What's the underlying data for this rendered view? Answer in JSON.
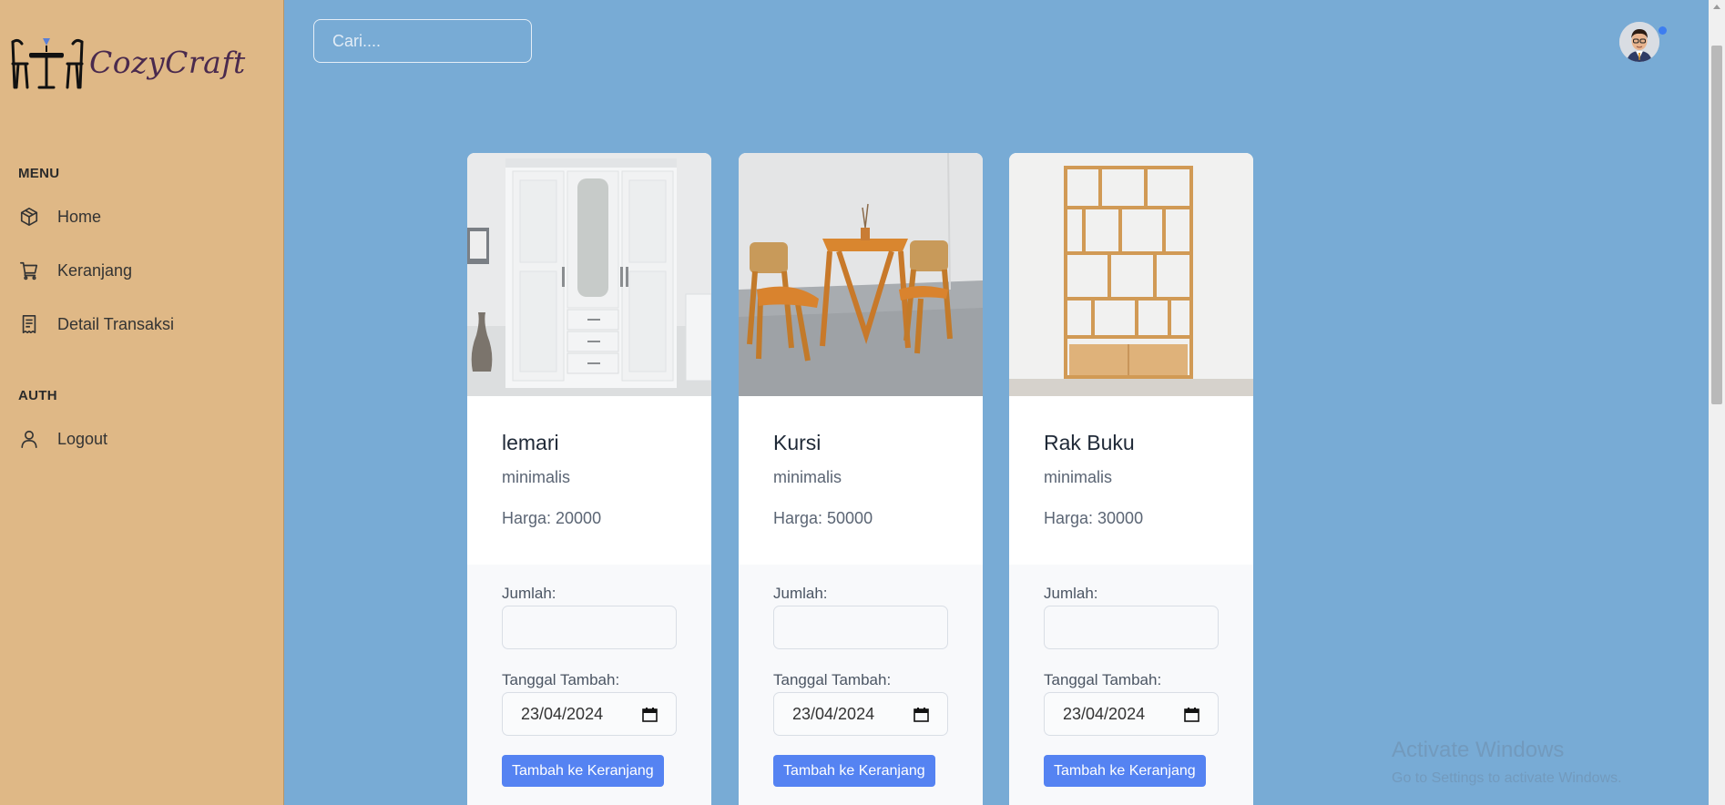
{
  "brand": {
    "name": "CozyCraft"
  },
  "sidebar": {
    "menu_title": "MENU",
    "items": [
      {
        "label": "Home",
        "icon": "box-icon"
      },
      {
        "label": "Keranjang",
        "icon": "cart-icon"
      },
      {
        "label": "Detail Transaksi",
        "icon": "receipt-icon"
      }
    ],
    "auth_title": "AUTH",
    "auth_items": [
      {
        "label": "Logout",
        "icon": "user-icon"
      }
    ]
  },
  "header": {
    "search_placeholder": "Cari....",
    "search_value": "",
    "avatar_icon": "avatar-icon",
    "status_color": "#3d7df0"
  },
  "products": [
    {
      "name": "lemari",
      "description": "minimalis",
      "price_text": "Harga: 20000",
      "image_icon": "wardrobe-image",
      "qty_label": "Jumlah:",
      "qty_value": "",
      "date_label": "Tanggal Tambah:",
      "date_value": "23/04/2024",
      "button_label": "Tambah ke Keranjang"
    },
    {
      "name": "Kursi",
      "description": "minimalis",
      "price_text": "Harga: 50000",
      "image_icon": "chairs-table-image",
      "qty_label": "Jumlah:",
      "qty_value": "",
      "date_label": "Tanggal Tambah:",
      "date_value": "23/04/2024",
      "button_label": "Tambah ke Keranjang"
    },
    {
      "name": "Rak Buku",
      "description": "minimalis",
      "price_text": "Harga: 30000",
      "image_icon": "bookshelf-image",
      "qty_label": "Jumlah:",
      "qty_value": "",
      "date_label": "Tanggal Tambah:",
      "date_value": "23/04/2024",
      "button_label": "Tambah ke Keranjang"
    }
  ],
  "watermark": {
    "title": "Activate Windows",
    "subtitle": "Go to Settings to activate Windows."
  },
  "colors": {
    "sidebar_bg": "#dfb886",
    "main_bg": "#78abd5",
    "button_bg": "#5583f2"
  }
}
